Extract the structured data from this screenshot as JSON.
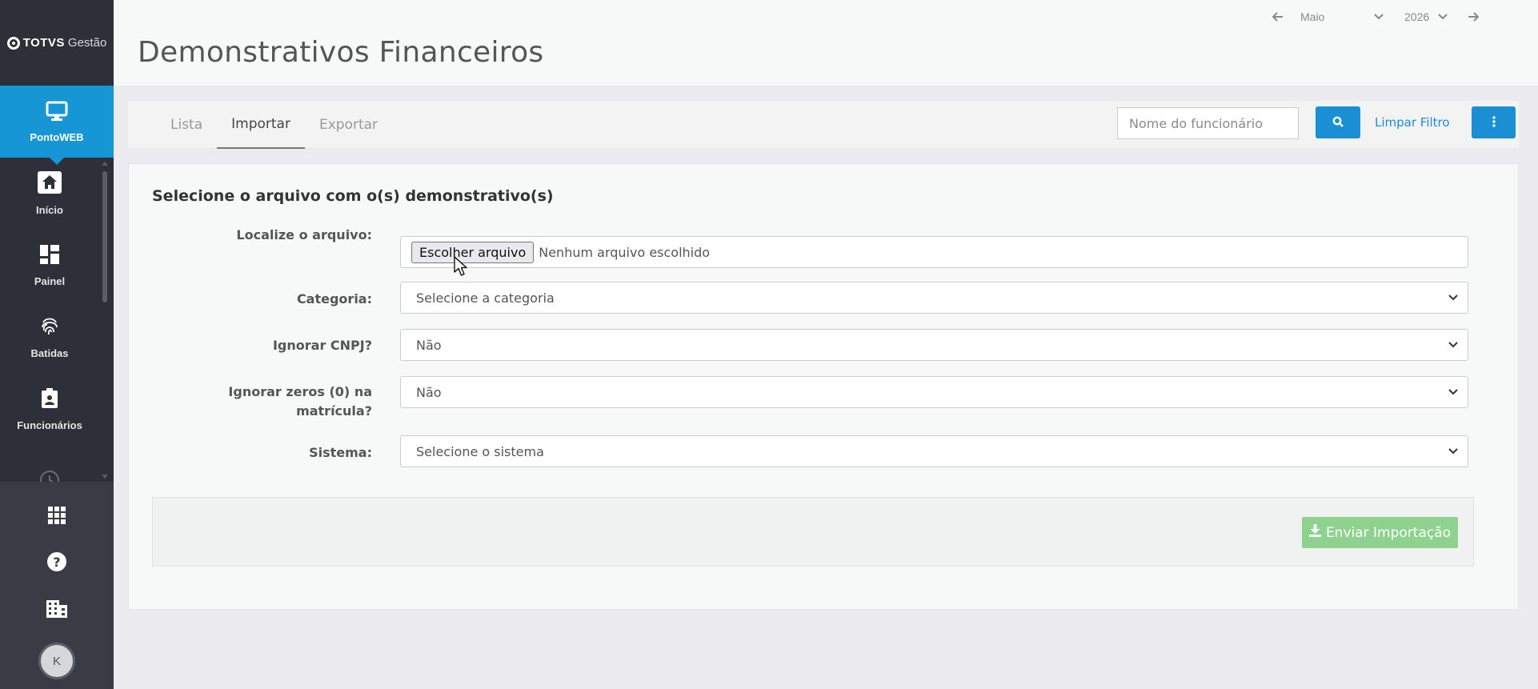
{
  "brand": {
    "name_strong": "TOTVS",
    "name_light": "Gestão"
  },
  "sidebar": {
    "active": {
      "label": "PontoWEB",
      "icon": "monitor-icon"
    },
    "items": [
      {
        "label": "Início",
        "icon": "home-icon"
      },
      {
        "label": "Painel",
        "icon": "dashboard-icon"
      },
      {
        "label": "Batidas",
        "icon": "fingerprint-icon"
      },
      {
        "label": "Funcionários",
        "icon": "employee-badge-icon"
      }
    ],
    "bottom_icons": [
      "apps-grid-icon",
      "help-icon",
      "building-icon"
    ],
    "avatar_initial": "K"
  },
  "header": {
    "title": "Demonstrativos Financeiros",
    "period": {
      "month": "Maio",
      "year": "2026"
    }
  },
  "toolbar": {
    "tabs": [
      {
        "label": "Lista",
        "active": false
      },
      {
        "label": "Importar",
        "active": true
      },
      {
        "label": "Exportar",
        "active": false
      }
    ],
    "search_placeholder": "Nome do funcionário",
    "clear_filter_label": "Limpar Filtro"
  },
  "form": {
    "title": "Selecione o arquivo com o(s) demonstrativo(s)",
    "file_label": "Localize o arquivo:",
    "file_button": "Escolher arquivo",
    "file_status": "Nenhum arquivo escolhido",
    "category_label": "Categoria:",
    "category_value": "Selecione a categoria",
    "ignore_cnpj_label": "Ignorar CNPJ?",
    "ignore_cnpj_value": "Não",
    "ignore_zeros_label_line1": "Ignorar zeros (0) na",
    "ignore_zeros_label_line2": "matrícula?",
    "ignore_zeros_value": "Não",
    "system_label": "Sistema:",
    "system_value": "Selecione o sistema",
    "submit_label": "Enviar Importação"
  },
  "colors": {
    "primary": "#1a8fd3",
    "sidebar": "#2d3038",
    "success_disabled": "#8fd28f"
  }
}
